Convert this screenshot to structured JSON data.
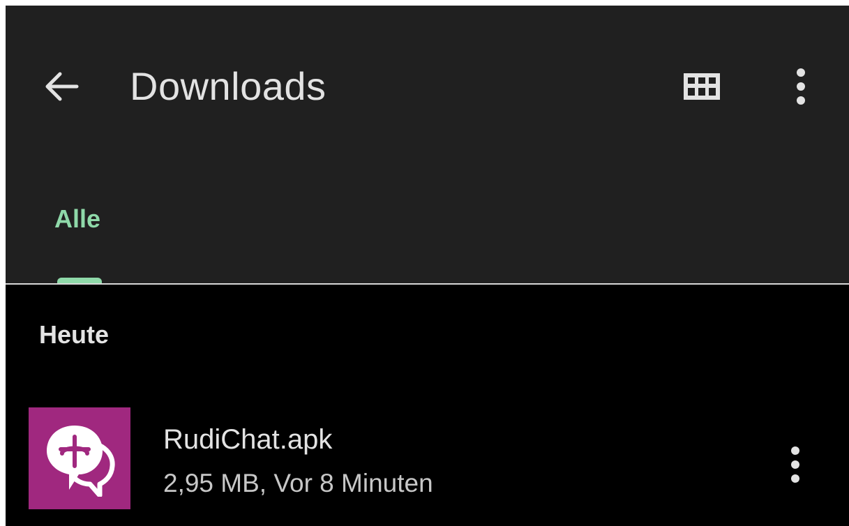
{
  "appbar": {
    "title": "Downloads",
    "back_icon": "arrow-back-icon",
    "grid_icon": "grid-view-icon",
    "more_icon": "more-vert-icon"
  },
  "tabs": [
    {
      "label": "Alle",
      "selected": true
    }
  ],
  "sections": [
    {
      "header": "Heute",
      "files": [
        {
          "name": "RudiChat.apk",
          "meta": "2,95 MB, Vor 8 Minuten",
          "icon": "rudichat-app-icon",
          "more_icon": "more-vert-icon"
        }
      ]
    }
  ],
  "colors": {
    "appbar_bg": "#202020",
    "content_bg": "#000000",
    "accent": "#8fd9a9",
    "text_primary": "#e3e3e3",
    "text_secondary": "#c7c7c7",
    "app_icon_bg": "#a0287f"
  }
}
